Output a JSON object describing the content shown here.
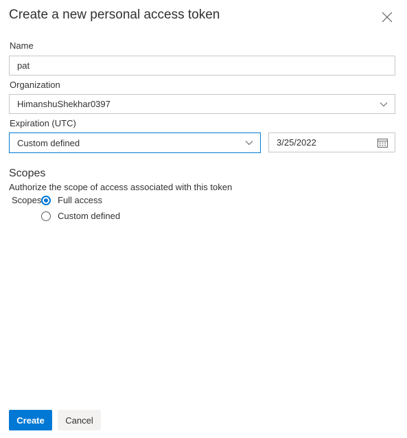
{
  "dialog": {
    "title": "Create a new personal access token",
    "close_icon": "close-icon"
  },
  "form": {
    "name_label": "Name",
    "name_value": "pat",
    "organization_label": "Organization",
    "organization_value": "HimanshuShekhar0397",
    "expiration_label": "Expiration (UTC)",
    "expiration_value": "Custom defined",
    "expiration_date": "3/25/2022",
    "calendar_icon": "calendar-icon"
  },
  "scopes": {
    "heading": "Scopes",
    "description": "Authorize the scope of access associated with this token",
    "label": "Scopes",
    "options": [
      {
        "label": "Full access",
        "checked": true
      },
      {
        "label": "Custom defined",
        "checked": false
      }
    ]
  },
  "actions": {
    "create_label": "Create",
    "cancel_label": "Cancel"
  },
  "colors": {
    "accent": "#0078d4",
    "border": "#c8c6c4",
    "text": "#323130"
  }
}
